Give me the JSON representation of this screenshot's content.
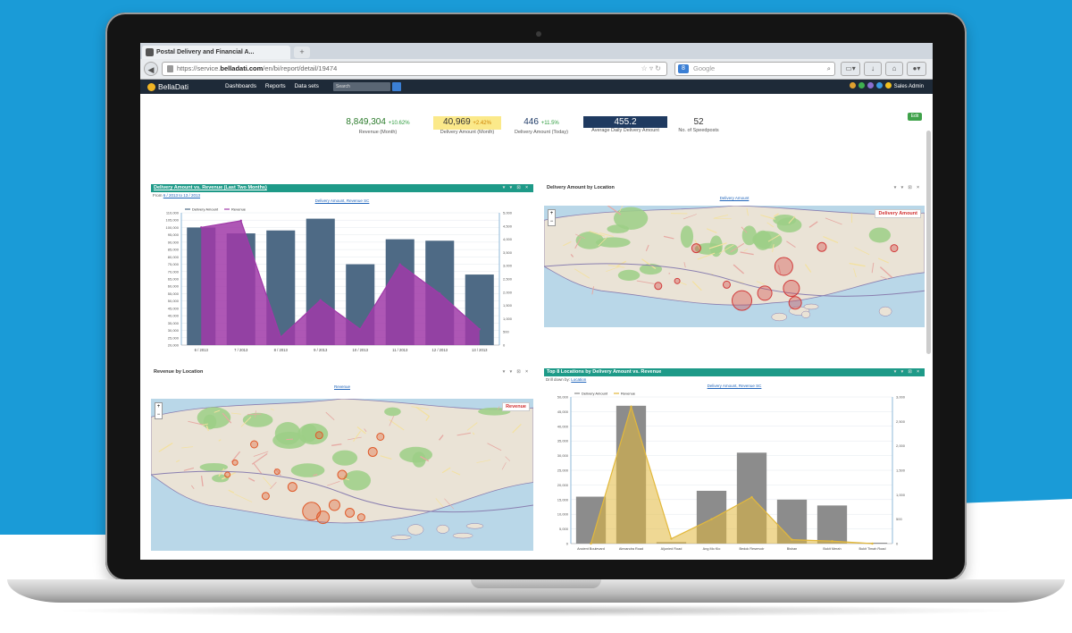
{
  "browser": {
    "tab_title": "Postal Delivery and Financial A...",
    "new_tab": "+",
    "url_prefix": "https://service.",
    "url_domain": "belladati.com",
    "url_path": "/en/bi/report/detail/19474",
    "search_placeholder": "Google",
    "search_engine_letter": "8"
  },
  "app": {
    "logo": "BellaDati",
    "nav": [
      "Dashboards",
      "Reports",
      "Data sets"
    ],
    "search_placeholder": "Search",
    "user": "Sales Admin",
    "edit_button": "Edit"
  },
  "kpis": [
    {
      "value": "8,849,304",
      "change": "+10.62%",
      "label": "Revenue (Month)",
      "style": "plain"
    },
    {
      "value": "40,969",
      "change": "+2.42%",
      "label": "Delivery Amount (Month)",
      "style": "yellow"
    },
    {
      "value": "446",
      "change": "+11.5%",
      "label": "Delivery Amount (Today)",
      "style": "plain"
    },
    {
      "value": "455.2",
      "change": "",
      "label": "Average Daily Delivery Amount",
      "style": "navy"
    },
    {
      "value": "52",
      "change": "",
      "label": "No. of Speedposts",
      "style": "plain"
    }
  ],
  "panel1": {
    "title": "Delivery Amount vs. Revenue (Last Two Months)",
    "subtitle_prefix": "From",
    "subtitle_range": "6 / 2013 to 13 / 2013",
    "legend_link": "Delivery Amount, Revenue SC"
  },
  "panel2": {
    "title": "Delivery Amount by Location",
    "legend_link": "Delivery Amount",
    "map_label": "Delivery Amount"
  },
  "panel3": {
    "title": "Revenue by Location",
    "legend_link": "Revenue",
    "map_label": "Revenue"
  },
  "panel4": {
    "title": "Top 8 Locations by Delivery Amount vs. Revenue",
    "subtitle_prefix": "Drill down by:",
    "subtitle_link": "Location",
    "legend_link": "Delivery Amount, Revenue SC"
  },
  "chart_data": [
    {
      "type": "bar",
      "title": "Delivery Amount vs. Revenue (Last Two Months)",
      "categories": [
        "6 / 2013",
        "7 / 2013",
        "8 / 2013",
        "9 / 2013",
        "10 / 2013",
        "11 / 2013",
        "12 / 2013",
        "13 / 2013"
      ],
      "series": [
        {
          "name": "Delivery Amount",
          "type": "bar",
          "values": [
            100000,
            96000,
            98000,
            106000,
            75000,
            92000,
            91000,
            68000
          ],
          "axis": "left",
          "color": "#4e6a85"
        },
        {
          "name": "Revenue",
          "type": "area",
          "values": [
            4450,
            4700,
            300,
            1700,
            600,
            3050,
            1950,
            600
          ],
          "axis": "right",
          "color": "#a03aa8"
        }
      ],
      "y_left_ticks": [
        "20,000",
        "25,000",
        "30,000",
        "35,000",
        "40,000",
        "45,000",
        "50,000",
        "55,000",
        "60,000",
        "65,000",
        "70,000",
        "75,000",
        "80,000",
        "85,000",
        "90,000",
        "95,000",
        "100,000",
        "105,000",
        "110,000"
      ],
      "y_right_ticks": [
        "0",
        "500",
        "1,000",
        "1,500",
        "2,000",
        "2,500",
        "3,000",
        "3,500",
        "4,000",
        "4,500",
        "5,000"
      ],
      "ylim_left": [
        20000,
        110000
      ],
      "ylim_right": [
        0,
        5000
      ],
      "legend": "top-left"
    },
    {
      "type": "bar",
      "title": "Top 8 Locations by Delivery Amount vs. Revenue",
      "categories": [
        "Ancient Boulevard",
        "Alexandra Road",
        "Aljunied Road",
        "Ang Mo Kio",
        "Bedok Reservoir",
        "Bishan",
        "Bukit Merah",
        "Bukit Timah Road"
      ],
      "series": [
        {
          "name": "Delivery Amount",
          "type": "bar",
          "values": [
            16000,
            47000,
            500,
            18000,
            31000,
            15000,
            13000,
            300
          ],
          "axis": "left",
          "color": "#8c8c8c"
        },
        {
          "name": "Revenue",
          "type": "area",
          "values": [
            0,
            2800,
            100,
            500,
            950,
            80,
            50,
            0
          ],
          "axis": "right",
          "color": "#e2b83c"
        }
      ],
      "y_left_ticks": [
        "0",
        "5,000",
        "10,000",
        "15,000",
        "20,000",
        "25,000",
        "30,000",
        "35,000",
        "40,000",
        "45,000",
        "50,000"
      ],
      "y_right_ticks": [
        "0",
        "500",
        "1,000",
        "1,500",
        "2,000",
        "2,500",
        "3,000"
      ],
      "ylim_left": [
        0,
        50000
      ],
      "ylim_right": [
        0,
        3000
      ],
      "legend": "top-left"
    }
  ]
}
